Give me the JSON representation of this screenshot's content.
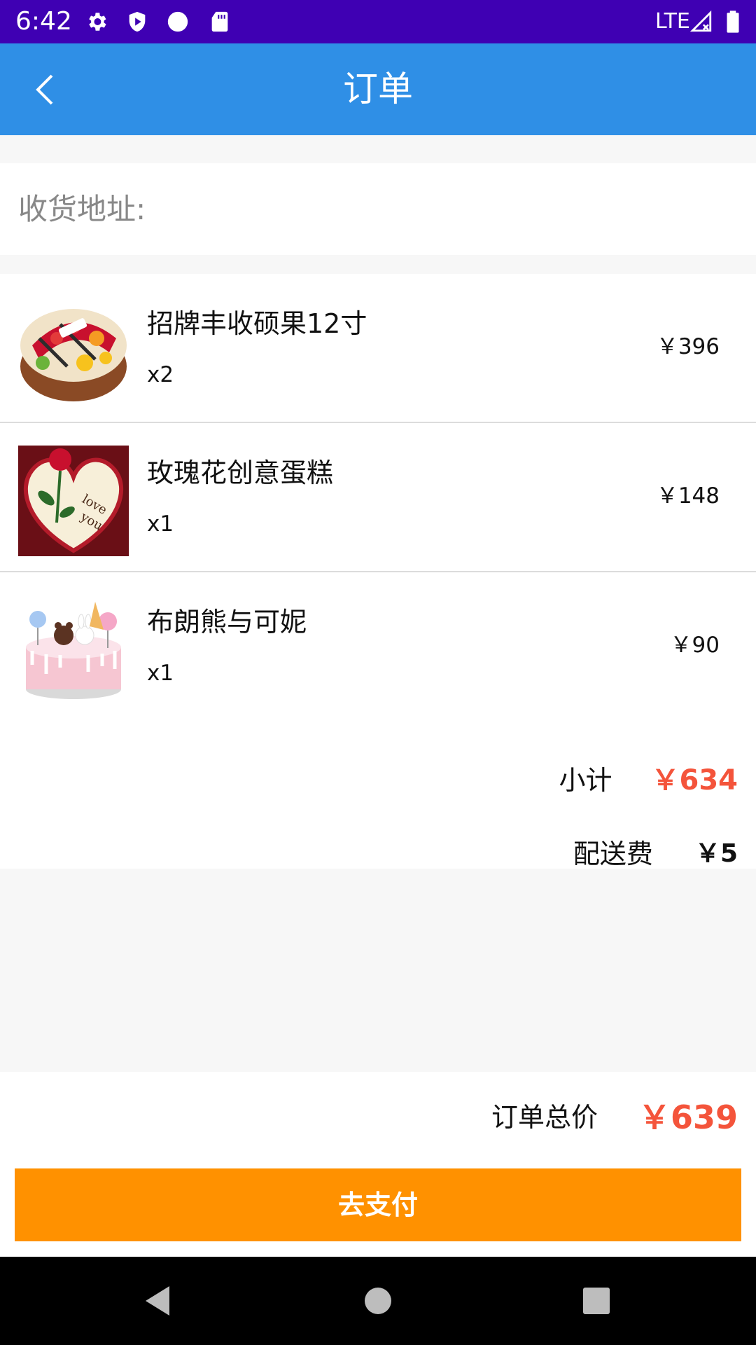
{
  "status_bar": {
    "time": "6:42",
    "network": "LTE",
    "icons": [
      "gear-icon",
      "shield-play-icon",
      "circle-icon",
      "sd-card-icon",
      "signal-icon",
      "battery-icon"
    ],
    "background_color": "#3f00b3"
  },
  "app_bar": {
    "title": "订单",
    "back_icon": "chevron-left-icon",
    "background_color": "#2f8fe6"
  },
  "address": {
    "label": "收货地址:"
  },
  "order_items": [
    {
      "name": "招牌丰收硕果12寸",
      "quantity": "x2",
      "price": "￥396",
      "image": "fruit-cake-image"
    },
    {
      "name": "玫瑰花创意蛋糕",
      "quantity": "x1",
      "price": "￥148",
      "image": "rose-heart-cake-image"
    },
    {
      "name": "布朗熊与可妮",
      "quantity": "x1",
      "price": "￥90",
      "image": "bear-bunny-cake-image"
    }
  ],
  "summary": {
    "subtotal_label": "小计",
    "subtotal_value": "￥634",
    "delivery_label": "配送费",
    "delivery_value": "￥5"
  },
  "footer": {
    "total_label": "订单总价",
    "total_value": "￥639",
    "pay_button_label": "去支付"
  },
  "colors": {
    "accent_price": "#f4543b",
    "pay_button": "#ff9100"
  },
  "nav_bar": {
    "buttons": [
      "back-triangle-icon",
      "home-circle-icon",
      "recents-square-icon"
    ]
  }
}
